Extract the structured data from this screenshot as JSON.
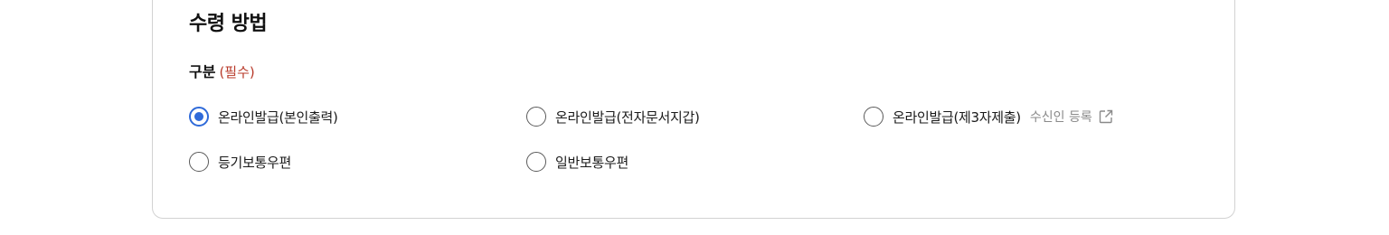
{
  "section": {
    "title": "수령 방법"
  },
  "field": {
    "label": "구분",
    "required": "(필수)"
  },
  "options": [
    {
      "label": "온라인발급(본인출력)",
      "selected": true
    },
    {
      "label": "온라인발급(전자문서지갑)",
      "selected": false
    },
    {
      "label": "온라인발급(제3자제출)",
      "selected": false
    },
    {
      "label": "등기보통우편",
      "selected": false
    },
    {
      "label": "일반보통우편",
      "selected": false
    }
  ],
  "recipient_link": {
    "label": "수신인 등록",
    "icon": "external-link-icon"
  },
  "colors": {
    "accent": "#2f6ad9",
    "required": "#b83a2a",
    "link": "#8a8a8a"
  }
}
